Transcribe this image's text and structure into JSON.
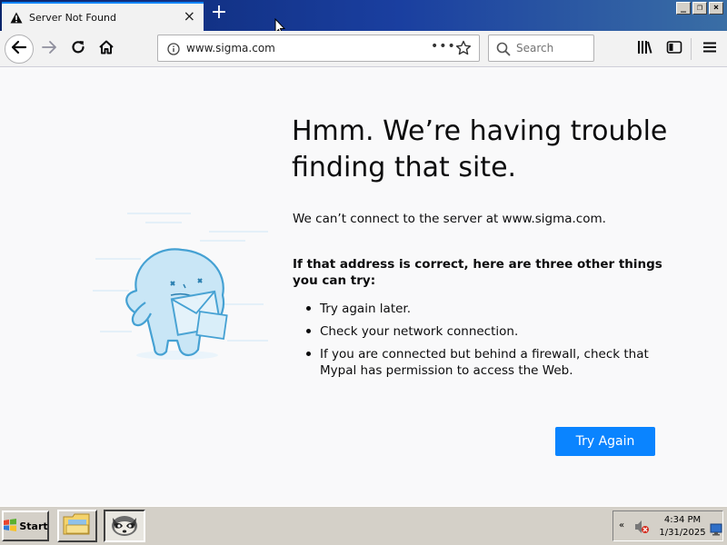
{
  "browser": {
    "tab": {
      "title": "Server Not Found",
      "close_glyph": "×"
    },
    "new_tab_glyph": "+",
    "window_controls": [
      "_",
      "❐",
      "×"
    ],
    "url": "www.sigma.com",
    "page_actions_glyph": "•••",
    "search_placeholder": "Search"
  },
  "page": {
    "headline_line1": "Hmm. We’re having trouble",
    "headline_line2": "finding that site.",
    "message": "We can’t connect to the server at www.sigma.com.",
    "subhead": "If that address is correct, here are three other things you can try:",
    "suggestions": [
      "Try again later.",
      "Check your network connection.",
      "If you are connected but behind a firewall, check that Mypal has permission to access the Web."
    ],
    "try_again_label": "Try Again"
  },
  "taskbar": {
    "start_label": "Start",
    "time": "4:34 PM",
    "date": "1/31/2025",
    "tray_chevron": "«"
  },
  "colors": {
    "accent": "#0a84ff",
    "titlebar": "#0a246a",
    "taskbar": "#d4d0c8",
    "content_bg": "#f9f9fa"
  },
  "icons": [
    "warning-icon",
    "close-icon",
    "plus-icon",
    "back-arrow-icon",
    "forward-arrow-icon",
    "reload-icon",
    "home-icon",
    "info-icon",
    "star-icon",
    "search-icon",
    "library-icon",
    "sidebar-icon",
    "menu-icon",
    "windows-logo-icon",
    "folder-icon",
    "raccoon-icon",
    "volume-muted-icon",
    "network-icon"
  ]
}
